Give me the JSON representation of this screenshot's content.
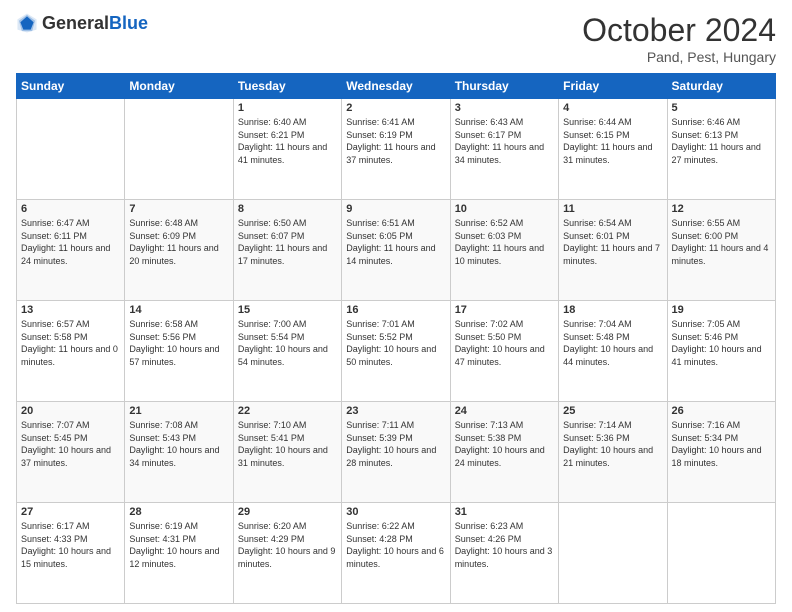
{
  "header": {
    "logo_general": "General",
    "logo_blue": "Blue",
    "month_title": "October 2024",
    "location": "Pand, Pest, Hungary"
  },
  "weekdays": [
    "Sunday",
    "Monday",
    "Tuesday",
    "Wednesday",
    "Thursday",
    "Friday",
    "Saturday"
  ],
  "weeks": [
    [
      {
        "day": "",
        "info": ""
      },
      {
        "day": "",
        "info": ""
      },
      {
        "day": "1",
        "info": "Sunrise: 6:40 AM\nSunset: 6:21 PM\nDaylight: 11 hours and 41 minutes."
      },
      {
        "day": "2",
        "info": "Sunrise: 6:41 AM\nSunset: 6:19 PM\nDaylight: 11 hours and 37 minutes."
      },
      {
        "day": "3",
        "info": "Sunrise: 6:43 AM\nSunset: 6:17 PM\nDaylight: 11 hours and 34 minutes."
      },
      {
        "day": "4",
        "info": "Sunrise: 6:44 AM\nSunset: 6:15 PM\nDaylight: 11 hours and 31 minutes."
      },
      {
        "day": "5",
        "info": "Sunrise: 6:46 AM\nSunset: 6:13 PM\nDaylight: 11 hours and 27 minutes."
      }
    ],
    [
      {
        "day": "6",
        "info": "Sunrise: 6:47 AM\nSunset: 6:11 PM\nDaylight: 11 hours and 24 minutes."
      },
      {
        "day": "7",
        "info": "Sunrise: 6:48 AM\nSunset: 6:09 PM\nDaylight: 11 hours and 20 minutes."
      },
      {
        "day": "8",
        "info": "Sunrise: 6:50 AM\nSunset: 6:07 PM\nDaylight: 11 hours and 17 minutes."
      },
      {
        "day": "9",
        "info": "Sunrise: 6:51 AM\nSunset: 6:05 PM\nDaylight: 11 hours and 14 minutes."
      },
      {
        "day": "10",
        "info": "Sunrise: 6:52 AM\nSunset: 6:03 PM\nDaylight: 11 hours and 10 minutes."
      },
      {
        "day": "11",
        "info": "Sunrise: 6:54 AM\nSunset: 6:01 PM\nDaylight: 11 hours and 7 minutes."
      },
      {
        "day": "12",
        "info": "Sunrise: 6:55 AM\nSunset: 6:00 PM\nDaylight: 11 hours and 4 minutes."
      }
    ],
    [
      {
        "day": "13",
        "info": "Sunrise: 6:57 AM\nSunset: 5:58 PM\nDaylight: 11 hours and 0 minutes."
      },
      {
        "day": "14",
        "info": "Sunrise: 6:58 AM\nSunset: 5:56 PM\nDaylight: 10 hours and 57 minutes."
      },
      {
        "day": "15",
        "info": "Sunrise: 7:00 AM\nSunset: 5:54 PM\nDaylight: 10 hours and 54 minutes."
      },
      {
        "day": "16",
        "info": "Sunrise: 7:01 AM\nSunset: 5:52 PM\nDaylight: 10 hours and 50 minutes."
      },
      {
        "day": "17",
        "info": "Sunrise: 7:02 AM\nSunset: 5:50 PM\nDaylight: 10 hours and 47 minutes."
      },
      {
        "day": "18",
        "info": "Sunrise: 7:04 AM\nSunset: 5:48 PM\nDaylight: 10 hours and 44 minutes."
      },
      {
        "day": "19",
        "info": "Sunrise: 7:05 AM\nSunset: 5:46 PM\nDaylight: 10 hours and 41 minutes."
      }
    ],
    [
      {
        "day": "20",
        "info": "Sunrise: 7:07 AM\nSunset: 5:45 PM\nDaylight: 10 hours and 37 minutes."
      },
      {
        "day": "21",
        "info": "Sunrise: 7:08 AM\nSunset: 5:43 PM\nDaylight: 10 hours and 34 minutes."
      },
      {
        "day": "22",
        "info": "Sunrise: 7:10 AM\nSunset: 5:41 PM\nDaylight: 10 hours and 31 minutes."
      },
      {
        "day": "23",
        "info": "Sunrise: 7:11 AM\nSunset: 5:39 PM\nDaylight: 10 hours and 28 minutes."
      },
      {
        "day": "24",
        "info": "Sunrise: 7:13 AM\nSunset: 5:38 PM\nDaylight: 10 hours and 24 minutes."
      },
      {
        "day": "25",
        "info": "Sunrise: 7:14 AM\nSunset: 5:36 PM\nDaylight: 10 hours and 21 minutes."
      },
      {
        "day": "26",
        "info": "Sunrise: 7:16 AM\nSunset: 5:34 PM\nDaylight: 10 hours and 18 minutes."
      }
    ],
    [
      {
        "day": "27",
        "info": "Sunrise: 6:17 AM\nSunset: 4:33 PM\nDaylight: 10 hours and 15 minutes."
      },
      {
        "day": "28",
        "info": "Sunrise: 6:19 AM\nSunset: 4:31 PM\nDaylight: 10 hours and 12 minutes."
      },
      {
        "day": "29",
        "info": "Sunrise: 6:20 AM\nSunset: 4:29 PM\nDaylight: 10 hours and 9 minutes."
      },
      {
        "day": "30",
        "info": "Sunrise: 6:22 AM\nSunset: 4:28 PM\nDaylight: 10 hours and 6 minutes."
      },
      {
        "day": "31",
        "info": "Sunrise: 6:23 AM\nSunset: 4:26 PM\nDaylight: 10 hours and 3 minutes."
      },
      {
        "day": "",
        "info": ""
      },
      {
        "day": "",
        "info": ""
      }
    ]
  ]
}
